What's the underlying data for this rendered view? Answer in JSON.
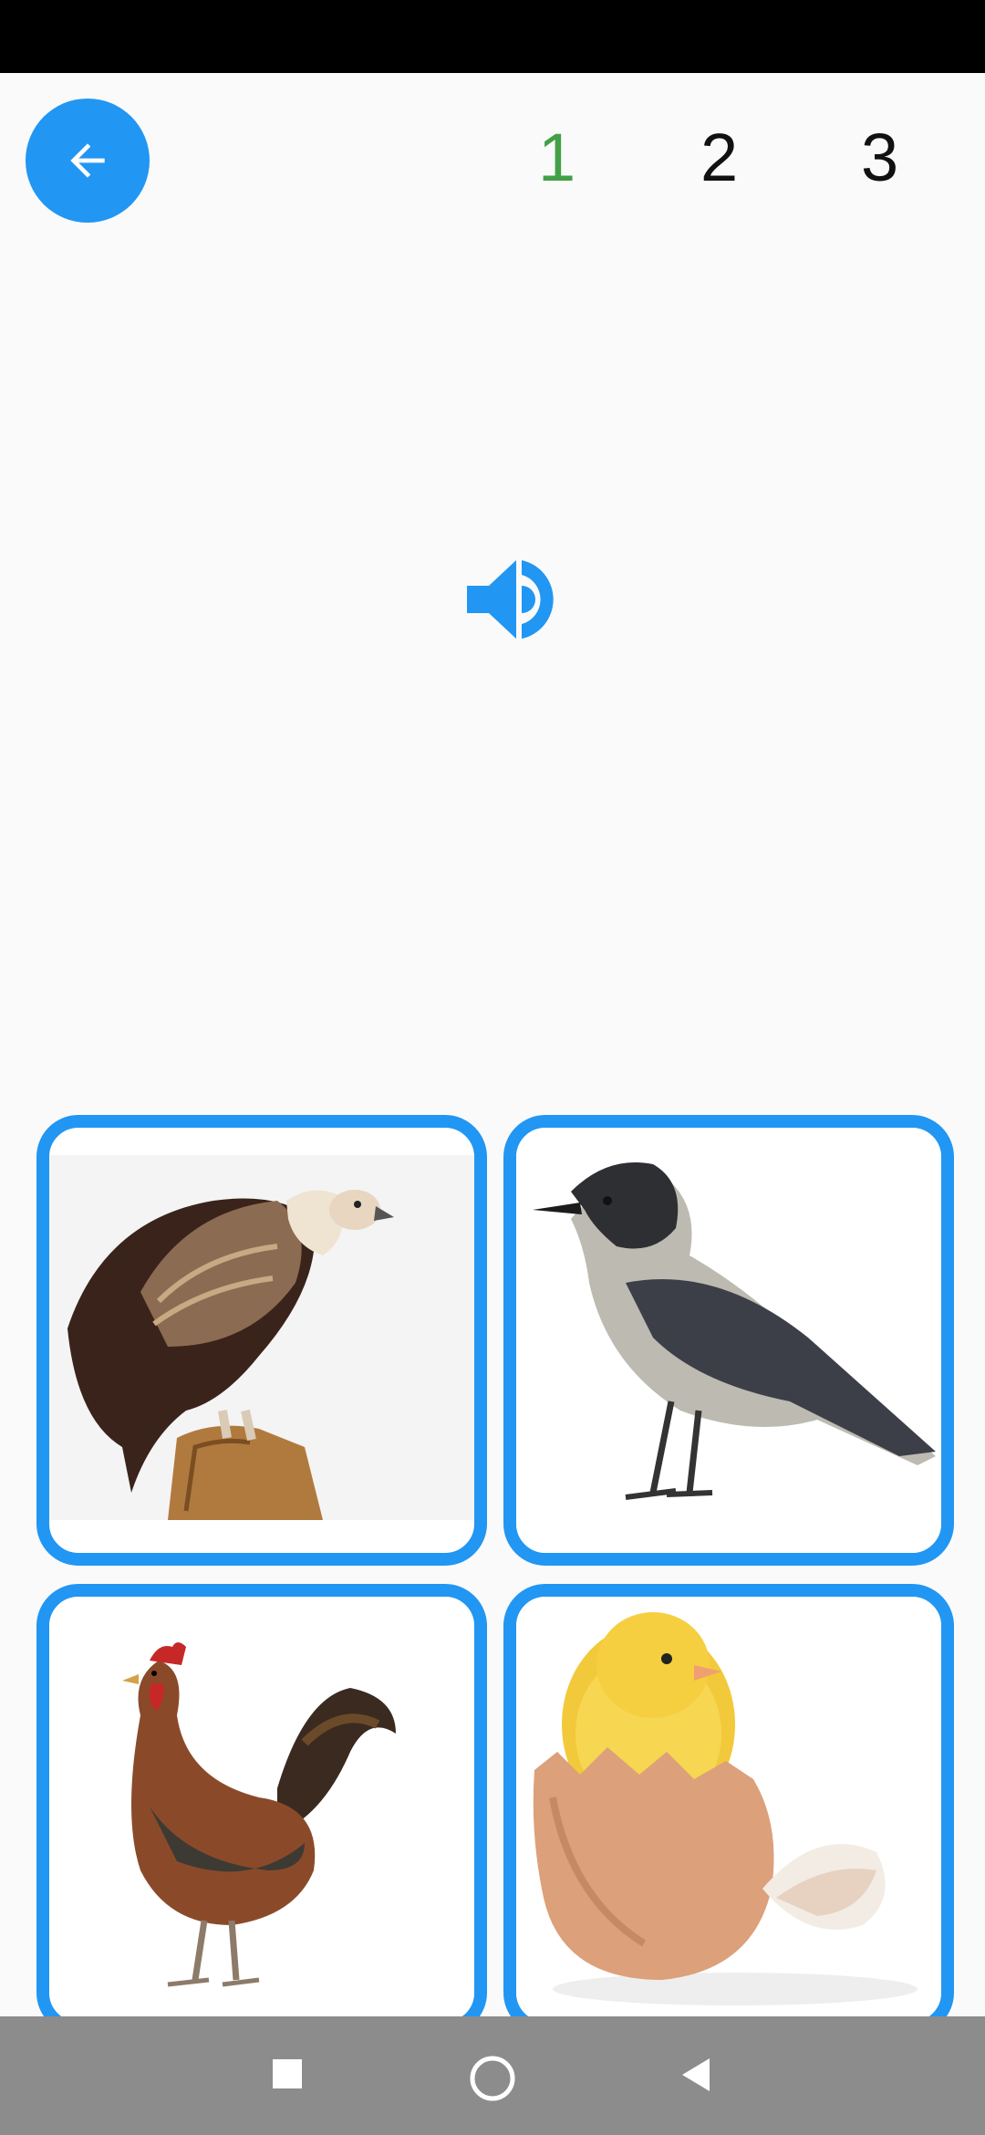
{
  "header": {
    "back_icon": "arrow-left-icon",
    "steps": [
      {
        "label": "1",
        "state": "active"
      },
      {
        "label": "2",
        "state": "default"
      },
      {
        "label": "3",
        "state": "default"
      }
    ]
  },
  "audio": {
    "icon": "speaker-icon"
  },
  "choices": [
    {
      "image": "vulture-image"
    },
    {
      "image": "crow-image"
    },
    {
      "image": "rooster-image"
    },
    {
      "image": "chick-in-egg-image"
    }
  ],
  "colors": {
    "accent": "#2196f3",
    "active_step": "#43a047",
    "background": "#fafafa",
    "nav_bar": "#8c8c8c"
  },
  "nav": {
    "recents_icon": "square-icon",
    "home_icon": "circle-icon",
    "back_icon": "triangle-back-icon"
  }
}
